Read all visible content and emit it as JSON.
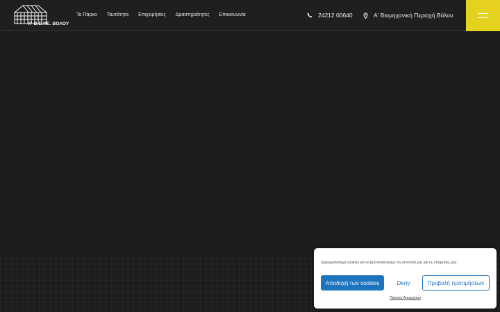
{
  "header": {
    "logo_text": "Α' Β.Ε.ΠΕ. ΒΟΛΟΥ",
    "nav": [
      {
        "label": "Το Πάρκο"
      },
      {
        "label": "Ταυτότητα"
      },
      {
        "label": "Επιχειρήσεις"
      },
      {
        "label": "Δραστηριότητες"
      },
      {
        "label": "Επικοινωνία"
      }
    ],
    "phone": "24212 00640",
    "location": "Α' Βιομηχανική Περιοχή Βόλου",
    "phone_icon": "phone-icon",
    "location_icon": "map-pin-icon",
    "menu_icon": "hamburger-menu-icon"
  },
  "cookie_banner": {
    "message": "Χρησιμοποιούμε cookies για να βελτιστοποιούμε τον ιστότοπό μας και τις υπηρεσίες μας.",
    "accept_label": "Αποδοχή των cookies",
    "deny_label": "Deny",
    "preferences_label": "Προβολή προτιμήσεων",
    "privacy_label": "Πολιτική Απορρήτου"
  },
  "colors": {
    "background": "#1c1c1c",
    "accent": "#e5d21f",
    "button_blue": "#1e73be"
  }
}
